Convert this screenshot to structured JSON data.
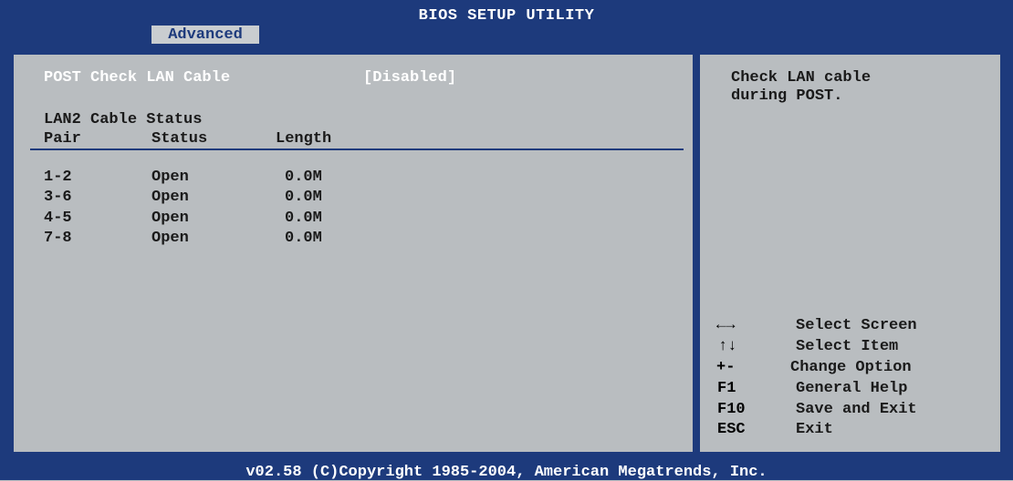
{
  "header": {
    "title": "BIOS SETUP UTILITY",
    "active_tab": "Advanced"
  },
  "main": {
    "option": {
      "label": "POST Check LAN Cable",
      "value": "[Disabled]"
    },
    "section_title": "LAN2 Cable Status",
    "columns": [
      "Pair",
      "Status",
      "Length"
    ],
    "rows": [
      {
        "pair": "1-2",
        "status": "Open",
        "length": "0.0M"
      },
      {
        "pair": "3-6",
        "status": "Open",
        "length": "0.0M"
      },
      {
        "pair": "4-5",
        "status": "Open",
        "length": "0.0M"
      },
      {
        "pair": "7-8",
        "status": "Open",
        "length": "0.0M"
      }
    ]
  },
  "help": {
    "description_line1": "Check LAN cable",
    "description_line2": "during POST.",
    "keys": [
      {
        "key": "←→",
        "icon": "left-right-arrows-icon",
        "action": "Select Screen"
      },
      {
        "key": "↑↓",
        "icon": "up-down-arrows-icon",
        "action": "Select Item"
      },
      {
        "key": "+-",
        "action": "Change Option"
      },
      {
        "key": "F1",
        "action": "General Help"
      },
      {
        "key": "F10",
        "action": "Save and Exit"
      },
      {
        "key": "ESC",
        "action": "Exit"
      }
    ]
  },
  "footer": {
    "copyright": "v02.58 (C)Copyright 1985-2004, American Megatrends, Inc."
  },
  "colors": {
    "frame": "#1d3a7c",
    "panel": "#b9bdc0",
    "tab": "#c9cdd0",
    "highlight": "#ffffff"
  }
}
